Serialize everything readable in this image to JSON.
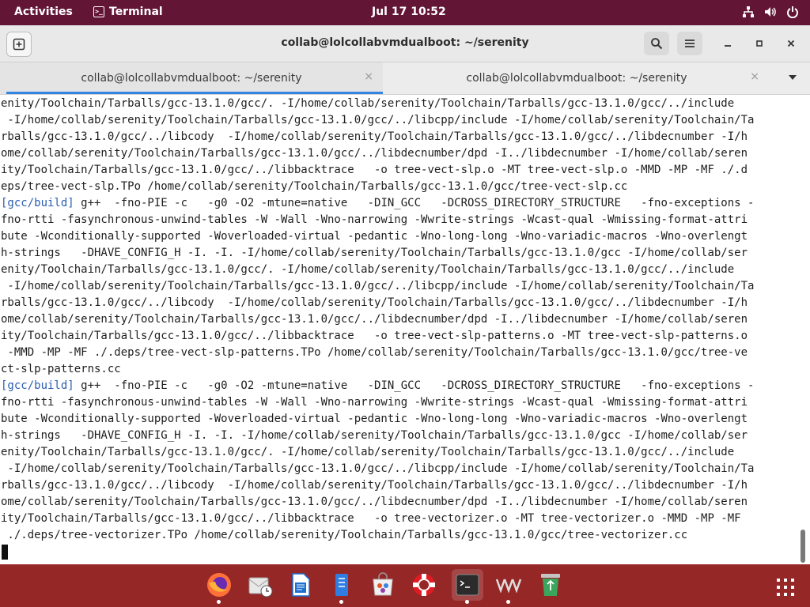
{
  "topbar": {
    "activities": "Activities",
    "app_name": "Terminal",
    "clock": "Jul 17  10:52",
    "icons": [
      "network-icon",
      "volume-icon",
      "power-icon"
    ]
  },
  "window": {
    "title": "collab@lolcollabvmdualboot: ~/serenity",
    "buttons": [
      "new-tab-icon",
      "search-icon",
      "hamburger-menu-icon",
      "minimize-icon",
      "maximize-icon",
      "close-icon"
    ]
  },
  "tabs": [
    {
      "label": "collab@lolcollabvmdualboot: ~/serenity",
      "active": true
    },
    {
      "label": "collab@lolcollabvmdualboot: ~/serenity",
      "active": false
    }
  ],
  "tab_close_glyph": "×",
  "terminal": {
    "lines": [
      {
        "prefix": "",
        "text": "enity/Toolchain/Tarballs/gcc-13.1.0/gcc/. -I/home/collab/serenity/Toolchain/Tarballs/gcc-13.1.0/gcc/../include"
      },
      {
        "prefix": "",
        "text": " -I/home/collab/serenity/Toolchain/Tarballs/gcc-13.1.0/gcc/../libcpp/include -I/home/collab/serenity/Toolchain/Ta"
      },
      {
        "prefix": "",
        "text": "rballs/gcc-13.1.0/gcc/../libcody  -I/home/collab/serenity/Toolchain/Tarballs/gcc-13.1.0/gcc/../libdecnumber -I/h"
      },
      {
        "prefix": "",
        "text": "ome/collab/serenity/Toolchain/Tarballs/gcc-13.1.0/gcc/../libdecnumber/dpd -I../libdecnumber -I/home/collab/seren"
      },
      {
        "prefix": "",
        "text": "ity/Toolchain/Tarballs/gcc-13.1.0/gcc/../libbacktrace   -o tree-vect-slp.o -MT tree-vect-slp.o -MMD -MP -MF ./.d"
      },
      {
        "prefix": "",
        "text": "eps/tree-vect-slp.TPo /home/collab/serenity/Toolchain/Tarballs/gcc-13.1.0/gcc/tree-vect-slp.cc"
      },
      {
        "prefix": "[gcc/build]",
        "text": " g++  -fno-PIE -c   -g0 -O2 -mtune=native   -DIN_GCC   -DCROSS_DIRECTORY_STRUCTURE   -fno-exceptions -"
      },
      {
        "prefix": "",
        "text": "fno-rtti -fasynchronous-unwind-tables -W -Wall -Wno-narrowing -Wwrite-strings -Wcast-qual -Wmissing-format-attri"
      },
      {
        "prefix": "",
        "text": "bute -Wconditionally-supported -Woverloaded-virtual -pedantic -Wno-long-long -Wno-variadic-macros -Wno-overlengt"
      },
      {
        "prefix": "",
        "text": "h-strings   -DHAVE_CONFIG_H -I. -I. -I/home/collab/serenity/Toolchain/Tarballs/gcc-13.1.0/gcc -I/home/collab/ser"
      },
      {
        "prefix": "",
        "text": "enity/Toolchain/Tarballs/gcc-13.1.0/gcc/. -I/home/collab/serenity/Toolchain/Tarballs/gcc-13.1.0/gcc/../include"
      },
      {
        "prefix": "",
        "text": " -I/home/collab/serenity/Toolchain/Tarballs/gcc-13.1.0/gcc/../libcpp/include -I/home/collab/serenity/Toolchain/Ta"
      },
      {
        "prefix": "",
        "text": "rballs/gcc-13.1.0/gcc/../libcody  -I/home/collab/serenity/Toolchain/Tarballs/gcc-13.1.0/gcc/../libdecnumber -I/h"
      },
      {
        "prefix": "",
        "text": "ome/collab/serenity/Toolchain/Tarballs/gcc-13.1.0/gcc/../libdecnumber/dpd -I../libdecnumber -I/home/collab/seren"
      },
      {
        "prefix": "",
        "text": "ity/Toolchain/Tarballs/gcc-13.1.0/gcc/../libbacktrace   -o tree-vect-slp-patterns.o -MT tree-vect-slp-patterns.o"
      },
      {
        "prefix": "",
        "text": " -MMD -MP -MF ./.deps/tree-vect-slp-patterns.TPo /home/collab/serenity/Toolchain/Tarballs/gcc-13.1.0/gcc/tree-ve"
      },
      {
        "prefix": "",
        "text": "ct-slp-patterns.cc"
      },
      {
        "prefix": "[gcc/build]",
        "text": " g++  -fno-PIE -c   -g0 -O2 -mtune=native   -DIN_GCC   -DCROSS_DIRECTORY_STRUCTURE   -fno-exceptions -"
      },
      {
        "prefix": "",
        "text": "fno-rtti -fasynchronous-unwind-tables -W -Wall -Wno-narrowing -Wwrite-strings -Wcast-qual -Wmissing-format-attri"
      },
      {
        "prefix": "",
        "text": "bute -Wconditionally-supported -Woverloaded-virtual -pedantic -Wno-long-long -Wno-variadic-macros -Wno-overlengt"
      },
      {
        "prefix": "",
        "text": "h-strings   -DHAVE_CONFIG_H -I. -I. -I/home/collab/serenity/Toolchain/Tarballs/gcc-13.1.0/gcc -I/home/collab/ser"
      },
      {
        "prefix": "",
        "text": "enity/Toolchain/Tarballs/gcc-13.1.0/gcc/. -I/home/collab/serenity/Toolchain/Tarballs/gcc-13.1.0/gcc/../include"
      },
      {
        "prefix": "",
        "text": " -I/home/collab/serenity/Toolchain/Tarballs/gcc-13.1.0/gcc/../libcpp/include -I/home/collab/serenity/Toolchain/Ta"
      },
      {
        "prefix": "",
        "text": "rballs/gcc-13.1.0/gcc/../libcody  -I/home/collab/serenity/Toolchain/Tarballs/gcc-13.1.0/gcc/../libdecnumber -I/h"
      },
      {
        "prefix": "",
        "text": "ome/collab/serenity/Toolchain/Tarballs/gcc-13.1.0/gcc/../libdecnumber/dpd -I../libdecnumber -I/home/collab/seren"
      },
      {
        "prefix": "",
        "text": "ity/Toolchain/Tarballs/gcc-13.1.0/gcc/../libbacktrace   -o tree-vectorizer.o -MT tree-vectorizer.o -MMD -MP -MF"
      },
      {
        "prefix": "",
        "text": " ./.deps/tree-vectorizer.TPo /home/collab/serenity/Toolchain/Tarballs/gcc-13.1.0/gcc/tree-vectorizer.cc"
      }
    ]
  },
  "dock": {
    "items": [
      {
        "name": "firefox-icon",
        "running": true
      },
      {
        "name": "evolution-icon",
        "running": false
      },
      {
        "name": "writer-icon",
        "running": false
      },
      {
        "name": "files-icon",
        "running": true
      },
      {
        "name": "software-icon",
        "running": false
      },
      {
        "name": "help-icon",
        "running": false
      },
      {
        "name": "terminal-icon",
        "running": true,
        "active": true
      },
      {
        "name": "vm-icon",
        "running": true
      },
      {
        "name": "trash-icon",
        "running": false
      }
    ],
    "apps_grid": "show-apps-icon"
  },
  "colors": {
    "topbar": "#631536",
    "dock": "#962727",
    "accent": "#3584e4",
    "prompt": "#2a5db0"
  }
}
